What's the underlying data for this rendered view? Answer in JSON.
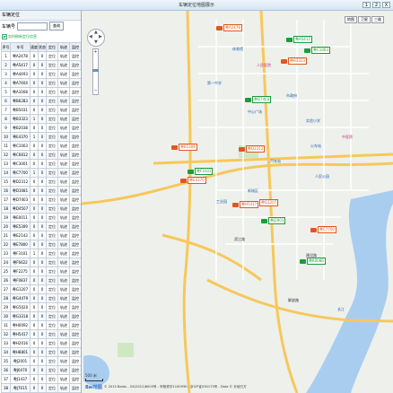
{
  "window": {
    "title": "车辆定位地图展示",
    "buttons": [
      "1",
      "2",
      "X"
    ]
  },
  "left_panel": {
    "heading": "车辆定位",
    "search_label": "车辆号",
    "search_value": "",
    "search_button": "查询",
    "checkbox_label": "实时刷新定位信息",
    "columns": [
      "序号",
      "车号",
      "速度",
      "状态",
      "定位",
      "轨迹",
      "监控"
    ],
    "rows": [
      {
        "n": "1",
        "car": "粤A2478",
        "speed": "0",
        "status": "0",
        "a": "定位",
        "b": "轨迹",
        "c": "监控"
      },
      {
        "n": "2",
        "car": "粤A5417",
        "speed": "0",
        "status": "0",
        "a": "定位",
        "b": "轨迹",
        "c": "监控"
      },
      {
        "n": "3",
        "car": "粤A4493",
        "speed": "0",
        "status": "0",
        "a": "定位",
        "b": "轨迹",
        "c": "监控"
      },
      {
        "n": "4",
        "car": "粤A7404",
        "speed": "0",
        "status": "0",
        "a": "定位",
        "b": "轨迹",
        "c": "监控"
      },
      {
        "n": "5",
        "car": "粤A1008",
        "speed": "0",
        "status": "0",
        "a": "定位",
        "b": "轨迹",
        "c": "监控"
      },
      {
        "n": "6",
        "car": "粤B6283",
        "speed": "0",
        "status": "0",
        "a": "定位",
        "b": "轨迹",
        "c": "监控"
      },
      {
        "n": "7",
        "car": "粤B5031",
        "speed": "0",
        "status": "0",
        "a": "定位",
        "b": "轨迹",
        "c": "监控"
      },
      {
        "n": "8",
        "car": "粤B3323",
        "speed": "1",
        "status": "0",
        "a": "定位",
        "b": "轨迹",
        "c": "监控"
      },
      {
        "n": "9",
        "car": "粤B2038",
        "speed": "0",
        "status": "0",
        "a": "定位",
        "b": "轨迹",
        "c": "监控"
      },
      {
        "n": "10",
        "car": "粤E4370",
        "speed": "1",
        "status": "0",
        "a": "定位",
        "b": "轨迹",
        "c": "监控"
      },
      {
        "n": "11",
        "car": "粤C1003",
        "speed": "0",
        "status": "0",
        "a": "定位",
        "b": "轨迹",
        "c": "监控"
      },
      {
        "n": "12",
        "car": "粤C6812",
        "speed": "0",
        "status": "0",
        "a": "定位",
        "b": "轨迹",
        "c": "监控"
      },
      {
        "n": "13",
        "car": "粤C3001",
        "speed": "0",
        "status": "0",
        "a": "定位",
        "b": "轨迹",
        "c": "监控"
      },
      {
        "n": "14",
        "car": "粤C7700",
        "speed": "1",
        "status": "0",
        "a": "定位",
        "b": "轨迹",
        "c": "监控"
      },
      {
        "n": "15",
        "car": "粤D2312",
        "speed": "0",
        "status": "0",
        "a": "定位",
        "b": "轨迹",
        "c": "监控"
      },
      {
        "n": "16",
        "car": "粤D1081",
        "speed": "0",
        "status": "0",
        "a": "定位",
        "b": "轨迹",
        "c": "监控"
      },
      {
        "n": "17",
        "car": "粤D7403",
        "speed": "0",
        "status": "0",
        "a": "定位",
        "b": "轨迹",
        "c": "监控"
      },
      {
        "n": "18",
        "car": "粤D4507",
        "speed": "0",
        "status": "0",
        "a": "定位",
        "b": "轨迹",
        "c": "监控"
      },
      {
        "n": "19",
        "car": "粤E0011",
        "speed": "0",
        "status": "0",
        "a": "定位",
        "b": "轨迹",
        "c": "监控"
      },
      {
        "n": "20",
        "car": "粤E5309",
        "speed": "0",
        "status": "0",
        "a": "定位",
        "b": "轨迹",
        "c": "监控"
      },
      {
        "n": "21",
        "car": "粤E2143",
        "speed": "0",
        "status": "0",
        "a": "定位",
        "b": "轨迹",
        "c": "监控"
      },
      {
        "n": "22",
        "car": "粤E7800",
        "speed": "0",
        "status": "0",
        "a": "定位",
        "b": "轨迹",
        "c": "监控"
      },
      {
        "n": "23",
        "car": "粤F3101",
        "speed": "1",
        "status": "0",
        "a": "定位",
        "b": "轨迹",
        "c": "监控"
      },
      {
        "n": "24",
        "car": "粤F6622",
        "speed": "0",
        "status": "0",
        "a": "定位",
        "b": "轨迹",
        "c": "监控"
      },
      {
        "n": "25",
        "car": "粤F2275",
        "speed": "0",
        "status": "0",
        "a": "定位",
        "b": "轨迹",
        "c": "监控"
      },
      {
        "n": "26",
        "car": "粤F0837",
        "speed": "0",
        "status": "0",
        "a": "定位",
        "b": "轨迹",
        "c": "监控"
      },
      {
        "n": "27",
        "car": "粤G1207",
        "speed": "0",
        "status": "0",
        "a": "定位",
        "b": "轨迹",
        "c": "监控"
      },
      {
        "n": "28",
        "car": "粤G4479",
        "speed": "0",
        "status": "0",
        "a": "定位",
        "b": "轨迹",
        "c": "监控"
      },
      {
        "n": "29",
        "car": "粤G5020",
        "speed": "0",
        "status": "0",
        "a": "定位",
        "b": "轨迹",
        "c": "监控"
      },
      {
        "n": "30",
        "car": "粤G3318",
        "speed": "0",
        "status": "0",
        "a": "定位",
        "b": "轨迹",
        "c": "监控"
      },
      {
        "n": "31",
        "car": "粤H0092",
        "speed": "0",
        "status": "0",
        "a": "定位",
        "b": "轨迹",
        "c": "监控"
      },
      {
        "n": "32",
        "car": "粤H5417",
        "speed": "0",
        "status": "0",
        "a": "定位",
        "b": "轨迹",
        "c": "监控"
      },
      {
        "n": "33",
        "car": "粤H2016",
        "speed": "0",
        "status": "0",
        "a": "定位",
        "b": "轨迹",
        "c": "监控"
      },
      {
        "n": "34",
        "car": "粤H8801",
        "speed": "0",
        "status": "0",
        "a": "定位",
        "b": "轨迹",
        "c": "监控"
      },
      {
        "n": "35",
        "car": "粤J2001",
        "speed": "0",
        "status": "0",
        "a": "定位",
        "b": "轨迹",
        "c": "监控"
      },
      {
        "n": "36",
        "car": "粤J6470",
        "speed": "0",
        "status": "0",
        "a": "定位",
        "b": "轨迹",
        "c": "监控"
      },
      {
        "n": "37",
        "car": "粤J1437",
        "speed": "0",
        "status": "0",
        "a": "定位",
        "b": "轨迹",
        "c": "监控"
      },
      {
        "n": "38",
        "car": "粤J7015",
        "speed": "0",
        "status": "0",
        "a": "定位",
        "b": "轨迹",
        "c": "监控"
      },
      {
        "n": "39",
        "car": "粤K0086",
        "speed": "0",
        "status": "0",
        "a": "定位",
        "b": "轨迹",
        "c": "监控"
      }
    ]
  },
  "map": {
    "tools": [
      "地图",
      "卫星",
      "三维"
    ],
    "labels": [
      {
        "t": "体育馆",
        "cls": "poi-blue"
      },
      {
        "t": "人民医院",
        "cls": "poi-pink"
      },
      {
        "t": "第一中学",
        "cls": "poi-blue"
      },
      {
        "t": "市政府",
        "cls": "poi-blue"
      },
      {
        "t": "中心广场",
        "cls": "poi-blue"
      },
      {
        "t": "实验小学",
        "cls": "poi-blue"
      },
      {
        "t": "中医院",
        "cls": "poi-pink"
      },
      {
        "t": "火车站",
        "cls": "poi-blue"
      },
      {
        "t": "汽车站",
        "cls": "poi-blue"
      },
      {
        "t": "人民公园",
        "cls": "poi-blue"
      },
      {
        "t": "新城区",
        "cls": "poi-blue"
      },
      {
        "t": "工业园",
        "cls": "poi-blue"
      },
      {
        "t": "滨江路",
        "cls": ""
      },
      {
        "t": "建设路",
        "cls": ""
      },
      {
        "t": "解放路",
        "cls": ""
      },
      {
        "t": "长江",
        "cls": "poi-blue"
      }
    ],
    "cars": [
      {
        "plate": "粤A2478",
        "color": "#e0581f"
      },
      {
        "plate": "粤A5417",
        "color": "#1e9b3a"
      },
      {
        "plate": "粤B3323",
        "color": "#e0581f"
      },
      {
        "plate": "粤C1003",
        "color": "#1e9b3a"
      },
      {
        "plate": "粤D2312",
        "color": "#e0581f"
      },
      {
        "plate": "粤E4370",
        "color": "#e0581f"
      },
      {
        "plate": "粤F3101",
        "color": "#1e9b3a"
      },
      {
        "plate": "粤G1207",
        "color": "#e0581f"
      },
      {
        "plate": "粤H5417",
        "color": "#e0581f"
      },
      {
        "plate": "粤J2001",
        "color": "#1e9b3a"
      },
      {
        "plate": "粤C7700",
        "color": "#e0581f"
      },
      {
        "plate": "粤K0086",
        "color": "#1e9b3a"
      },
      {
        "plate": "粤E5309",
        "color": "#e0581f"
      },
      {
        "plate": "粤D7403",
        "color": "#1e9b3a"
      }
    ],
    "scale_label": "500 米",
    "baidu_logo": "Bai地图",
    "copyright": "© 2015 Baidu - GS(2012)6003号 - 甲测资字1100930 - 京ICP证030173号 - Data © 长地万方"
  }
}
